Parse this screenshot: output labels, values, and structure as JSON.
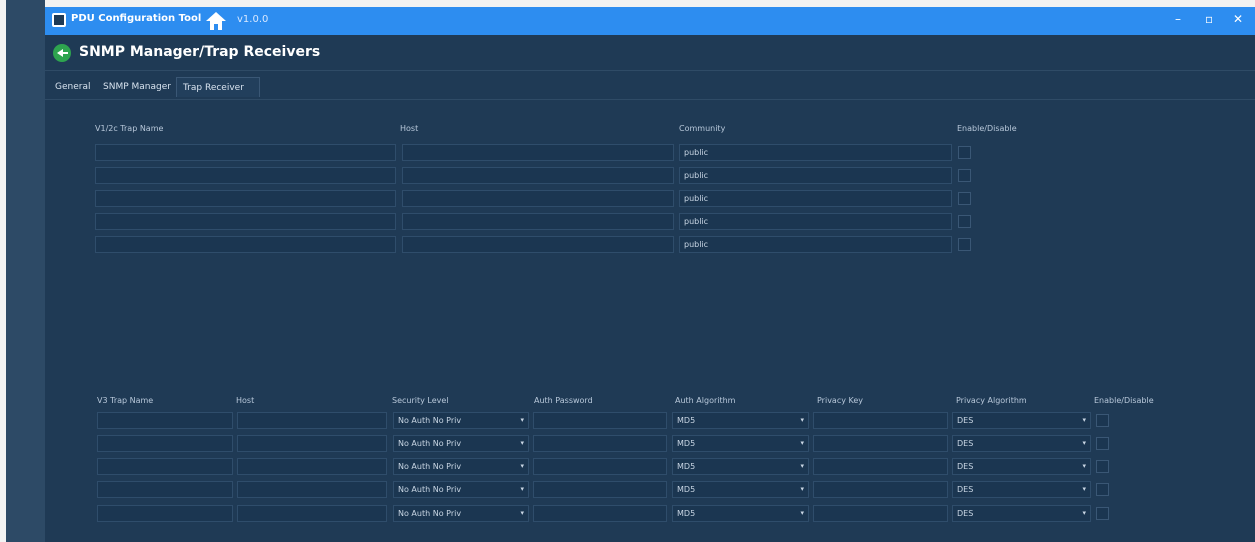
{
  "titlebar": {
    "app_name": "PDU Configuration Tool",
    "version": "v1.0.0",
    "minimize": "–",
    "maximize": "▫",
    "close": "✕"
  },
  "header": {
    "title": "SNMP Manager/Trap Receivers"
  },
  "tabs": [
    {
      "label": "General"
    },
    {
      "label": "SNMP Manager"
    },
    {
      "label": "Trap Receiver"
    }
  ],
  "v2": {
    "headers": {
      "name": "V1/2c Trap Name",
      "host": "Host",
      "community": "Community",
      "enable": "Enable/Disable"
    },
    "rows": [
      {
        "name": "",
        "host": "",
        "community": "public",
        "enabled": false
      },
      {
        "name": "",
        "host": "",
        "community": "public",
        "enabled": false
      },
      {
        "name": "",
        "host": "",
        "community": "public",
        "enabled": false
      },
      {
        "name": "",
        "host": "",
        "community": "public",
        "enabled": false
      },
      {
        "name": "",
        "host": "",
        "community": "public",
        "enabled": false
      }
    ]
  },
  "v3": {
    "headers": {
      "name": "V3 Trap Name",
      "host": "Host",
      "security": "Security Level",
      "auth_password": "Auth Password",
      "auth_algorithm": "Auth Algorithm",
      "privacy_key": "Privacy Key",
      "privacy_algorithm": "Privacy Algorithm",
      "enable": "Enable/Disable"
    },
    "rows": [
      {
        "name": "",
        "host": "",
        "security": "No Auth No Priv",
        "auth_password": "",
        "auth_algorithm": "MD5",
        "privacy_key": "",
        "privacy_algorithm": "DES",
        "enabled": false
      },
      {
        "name": "",
        "host": "",
        "security": "No Auth No Priv",
        "auth_password": "",
        "auth_algorithm": "MD5",
        "privacy_key": "",
        "privacy_algorithm": "DES",
        "enabled": false
      },
      {
        "name": "",
        "host": "",
        "security": "No Auth No Priv",
        "auth_password": "",
        "auth_algorithm": "MD5",
        "privacy_key": "",
        "privacy_algorithm": "DES",
        "enabled": false
      },
      {
        "name": "",
        "host": "",
        "security": "No Auth No Priv",
        "auth_password": "",
        "auth_algorithm": "MD5",
        "privacy_key": "",
        "privacy_algorithm": "DES",
        "enabled": false
      },
      {
        "name": "",
        "host": "",
        "security": "No Auth No Priv",
        "auth_password": "",
        "auth_algorithm": "MD5",
        "privacy_key": "",
        "privacy_algorithm": "DES",
        "enabled": false
      }
    ]
  },
  "caret": "▾",
  "colors": {
    "titlebar": "#2d8df0",
    "background": "#1f3a55",
    "accent_back": "#2ea44f"
  }
}
